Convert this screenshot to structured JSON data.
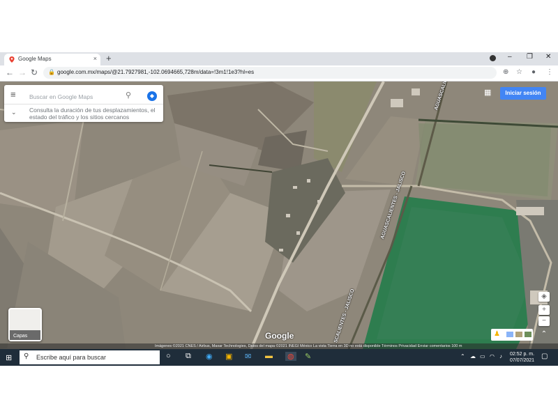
{
  "browser": {
    "tab_title": "Google Maps",
    "tab_close": "×",
    "new_tab": "+",
    "window_controls": [
      "–",
      "❐",
      "✕"
    ],
    "back": "←",
    "forward": "→",
    "reload": "↻",
    "url": "google.com.mx/maps/@21.7927981,-102.0694665,728m/data=!3m1!1e3?hl=es"
  },
  "maps": {
    "search_placeholder": "Buscar en Google Maps",
    "hint": "Consulta la duración de tus desplazamientos, el estado del tráfico y los sitios cercanos",
    "sign_in": "Iniciar sesión",
    "layers_label": "Capas",
    "logo": "Google",
    "road_labels": [
      "AGUASCALIENTES - JALISCO",
      "AGUASCALIENTES - JALISCO",
      "SCALIENTES - JALISCO"
    ],
    "attribution": "Imágenes ©2021 CNES / Airbus, Maxar Technologies, Datos del mapa ©2021 INEGI    México    La vista Tierra en 3D no está disponible    Términos    Privacidad    Enviar comentarios    100 m",
    "zoom_in": "+",
    "zoom_out": "−"
  },
  "taskbar": {
    "search_text": "Escribe aquí para buscar",
    "time": "02:52 p. m.",
    "date": "07/07/2021"
  },
  "colors": {
    "signin": "#4285f4",
    "taskbar": "#1f2d3a",
    "green_field": "#2e7d4f"
  }
}
